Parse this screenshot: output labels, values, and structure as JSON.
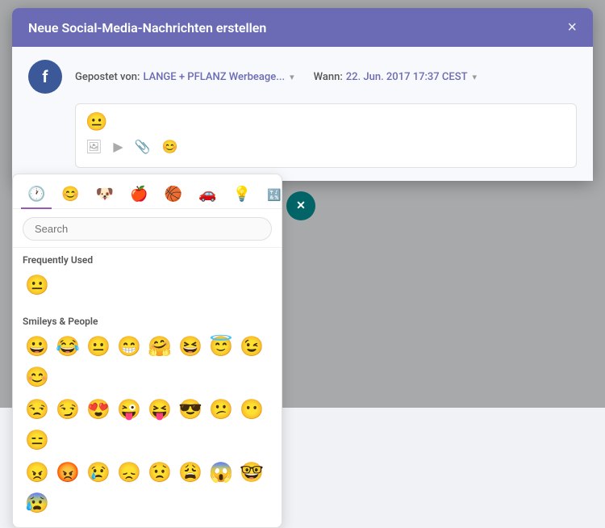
{
  "modal": {
    "title": "Neue Social-Media-Nachrichten erstellen",
    "close_label": "×"
  },
  "post": {
    "posted_by_label": "Gepostet von:",
    "posted_by_value": "LANGE + PFLANZ Werbeage...",
    "when_label": "Wann:",
    "when_value": "22. Jun. 2017 17:37 CEST",
    "emoji_preview": "😐"
  },
  "emoji_picker": {
    "search_placeholder": "Search",
    "frequently_used_label": "Frequently Used",
    "smileys_label": "Smileys & People",
    "frequently_used": [
      "😐"
    ],
    "smileys_row1": [
      "😀",
      "😂",
      "😐",
      "😁",
      "🤗",
      "😆",
      "😇",
      "😉",
      "😊"
    ],
    "smileys_row2": [
      "😒",
      "😏",
      "😍",
      "😜",
      "😝",
      "😎",
      "😕",
      "😶",
      "😑"
    ],
    "smileys_row3": [
      "😠",
      "😡",
      "😢",
      "😞",
      "😟",
      "😩",
      "😱",
      "🤓",
      "😰"
    ]
  },
  "emoji_tabs": [
    {
      "icon": "🕐",
      "label": "recent",
      "active": true
    },
    {
      "icon": "😊",
      "label": "smileys"
    },
    {
      "icon": "🐶",
      "label": "animals"
    },
    {
      "icon": "🍎",
      "label": "food"
    },
    {
      "icon": "🏀",
      "label": "activities"
    },
    {
      "icon": "🚗",
      "label": "travel"
    },
    {
      "icon": "💡",
      "label": "objects"
    },
    {
      "icon": "🔣",
      "label": "symbols"
    }
  ]
}
